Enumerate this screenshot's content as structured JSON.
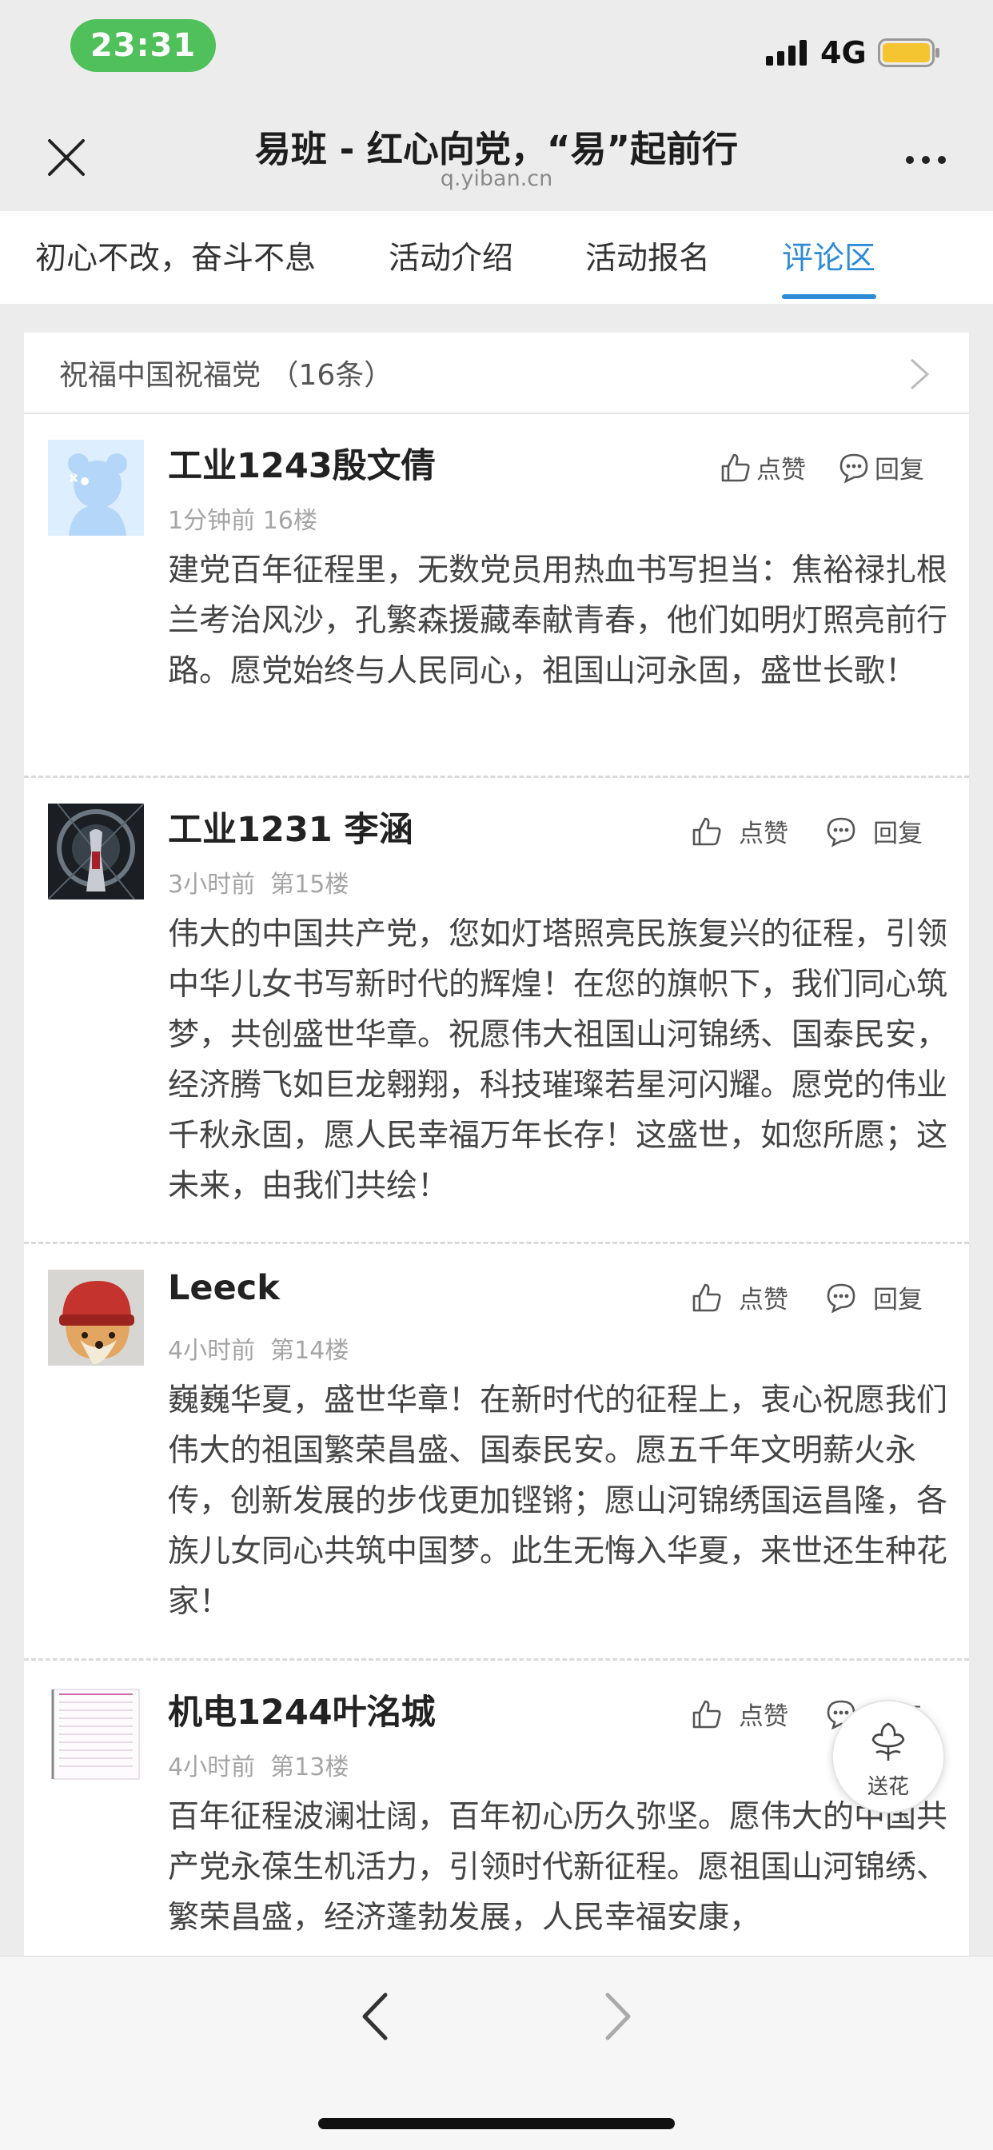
{
  "status": {
    "time": "23:31",
    "network": "4G"
  },
  "header": {
    "title": "易班 - 红心向党，“易”起前行",
    "url": "q.yiban.cn"
  },
  "tabs": [
    {
      "label": "初心不改，奋斗不息"
    },
    {
      "label": "活动介绍"
    },
    {
      "label": "活动报名"
    },
    {
      "label": "评论区"
    }
  ],
  "panel": {
    "title": "祝福中国祝福党 （16条）"
  },
  "comments": [
    {
      "name": "工业1243殷文倩",
      "time": "1分钟前",
      "floor": "16楼",
      "like": "点赞",
      "reply": "回复",
      "text": "建党百年征程里，无数党员用热血书写担当：焦裕禄扎根兰考治风沙，孔繁森援藏奉献青春，他们如明灯照亮前行路。愿党始终与人民同心，祖国山河永固，盛世长歌！"
    },
    {
      "name": "工业1231 李涵",
      "time": "3小时前",
      "floor": "第15楼",
      "like": "点赞",
      "reply": "回复",
      "text": "伟大的中国共产党，您如灯塔照亮民族复兴的征程，引领中华儿女书写新时代的辉煌！在您的旗帜下，我们同心筑梦，共创盛世华章。祝愿伟大祖国山河锦绣、国泰民安，经济腾飞如巨龙翱翔，科技璀璨若星河闪耀。愿党的伟业千秋永固，愿人民幸福万年长存！这盛世，如您所愿；这未来，由我们共绘！"
    },
    {
      "name": "Leeck",
      "time": "4小时前",
      "floor": "第14楼",
      "like": "点赞",
      "reply": "回复",
      "text": "巍巍华夏，盛世华章！在新时代的征程上，衷心祝愿我们伟大的祖国繁荣昌盛、国泰民安。愿五千年文明薪火永传，创新发展的步伐更加铿锵；愿山河锦绣国运昌隆，各族儿女同心共筑中国梦。此生无悔入华夏，来世还生种花家！"
    },
    {
      "name": "机电1244叶洺城",
      "time": "4小时前",
      "floor": "第13楼",
      "like": "点赞",
      "reply": "回复",
      "text": "百年征程波澜壮阔，百年初心历久弥坚。愿伟大的中国共产党永葆生机活力，引领时代新征程。愿祖国山河锦绣、繁荣昌盛，经济蓬勃发展，人民幸福安康，"
    }
  ],
  "flower": {
    "label": "送花"
  },
  "colors": {
    "accent": "#2e8bd7",
    "time_pill": "#4fc05a",
    "battery": "#f5c431"
  }
}
